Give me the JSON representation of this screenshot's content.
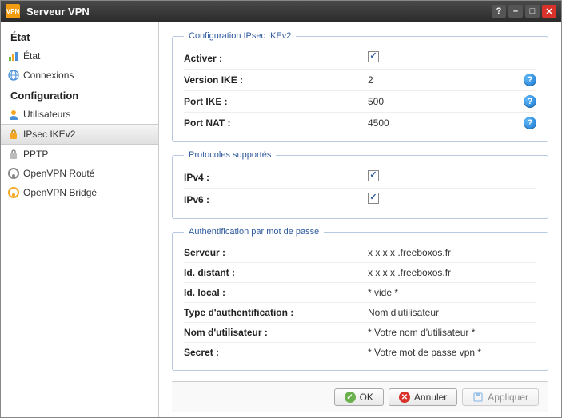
{
  "titlebar": {
    "title": "Serveur VPN"
  },
  "sidebar": {
    "sections": [
      {
        "title": "État",
        "items": [
          {
            "label": "État",
            "icon": "chart"
          },
          {
            "label": "Connexions",
            "icon": "globe"
          }
        ]
      },
      {
        "title": "Configuration",
        "items": [
          {
            "label": "Utilisateurs",
            "icon": "user"
          },
          {
            "label": "IPsec IKEv2",
            "icon": "lock-yellow",
            "selected": true
          },
          {
            "label": "PPTP",
            "icon": "lock-grey"
          },
          {
            "label": "OpenVPN Routé",
            "icon": "ovpn-grey"
          },
          {
            "label": "OpenVPN Bridgé",
            "icon": "ovpn-orange"
          }
        ]
      }
    ]
  },
  "panels": {
    "ipsec": {
      "legend": "Configuration IPsec IKEv2",
      "rows": [
        {
          "label": "Activer :",
          "type": "checkbox",
          "checked": true
        },
        {
          "label": "Version IKE :",
          "type": "text",
          "value": "2",
          "help": true
        },
        {
          "label": "Port IKE :",
          "type": "text",
          "value": "500",
          "help": true
        },
        {
          "label": "Port NAT :",
          "type": "text",
          "value": "4500",
          "help": true
        }
      ]
    },
    "protocols": {
      "legend": "Protocoles supportés",
      "rows": [
        {
          "label": "IPv4 :",
          "type": "checkbox",
          "checked": true
        },
        {
          "label": "IPv6 :",
          "type": "checkbox",
          "checked": true
        }
      ]
    },
    "auth": {
      "legend": "Authentification par mot de passe",
      "rows": [
        {
          "label": "Serveur :",
          "type": "text",
          "value": "x x x x .freeboxos.fr"
        },
        {
          "label": "Id. distant :",
          "type": "text",
          "value": "x x x x .freeboxos.fr"
        },
        {
          "label": "Id. local :",
          "type": "text",
          "value": "* vide *"
        },
        {
          "label": "Type d'authentification :",
          "type": "text",
          "value": "Nom d'utilisateur"
        },
        {
          "label": "Nom d'utilisateur :",
          "type": "text",
          "value": "* Votre nom d'utilisateur *"
        },
        {
          "label": "Secret :",
          "type": "text",
          "value": "* Votre mot de passe vpn *"
        }
      ]
    }
  },
  "footer": {
    "ok": "OK",
    "cancel": "Annuler",
    "apply": "Appliquer"
  }
}
